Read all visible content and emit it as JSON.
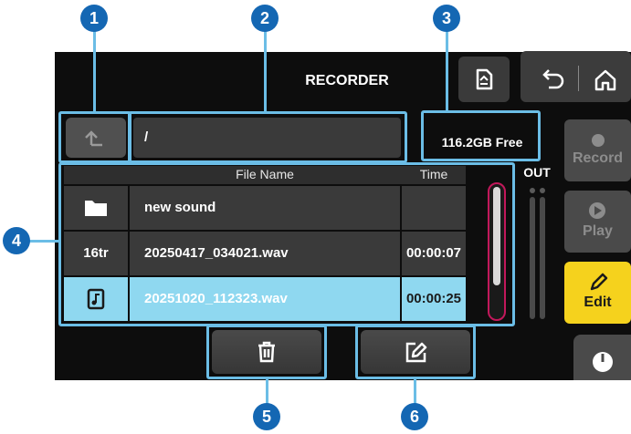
{
  "header": {
    "title": "RECORDER"
  },
  "path": {
    "value": "/"
  },
  "storage": {
    "free": "116.2GB Free"
  },
  "table": {
    "col_name": "File Name",
    "col_time": "Time",
    "rows": [
      {
        "type": "folder-icon",
        "name": "new sound",
        "time": ""
      },
      {
        "type_label": "16tr",
        "name": "20250417_034021.wav",
        "time": "00:00:07"
      },
      {
        "type": "music-file-icon",
        "name": "20251020_112323.wav",
        "time": "00:00:25",
        "selected": true
      }
    ]
  },
  "meter": {
    "label": "OUT"
  },
  "side_buttons": {
    "record": "Record",
    "play": "Play",
    "edit": "Edit"
  },
  "callouts": [
    "1",
    "2",
    "3",
    "4",
    "5",
    "6"
  ],
  "colors": {
    "selected_row": "#8fd8f0",
    "edit_button": "#f5d21d",
    "callout": "#1467b3",
    "frame": "#6bbde6",
    "scroll_border": "#c2185b"
  }
}
